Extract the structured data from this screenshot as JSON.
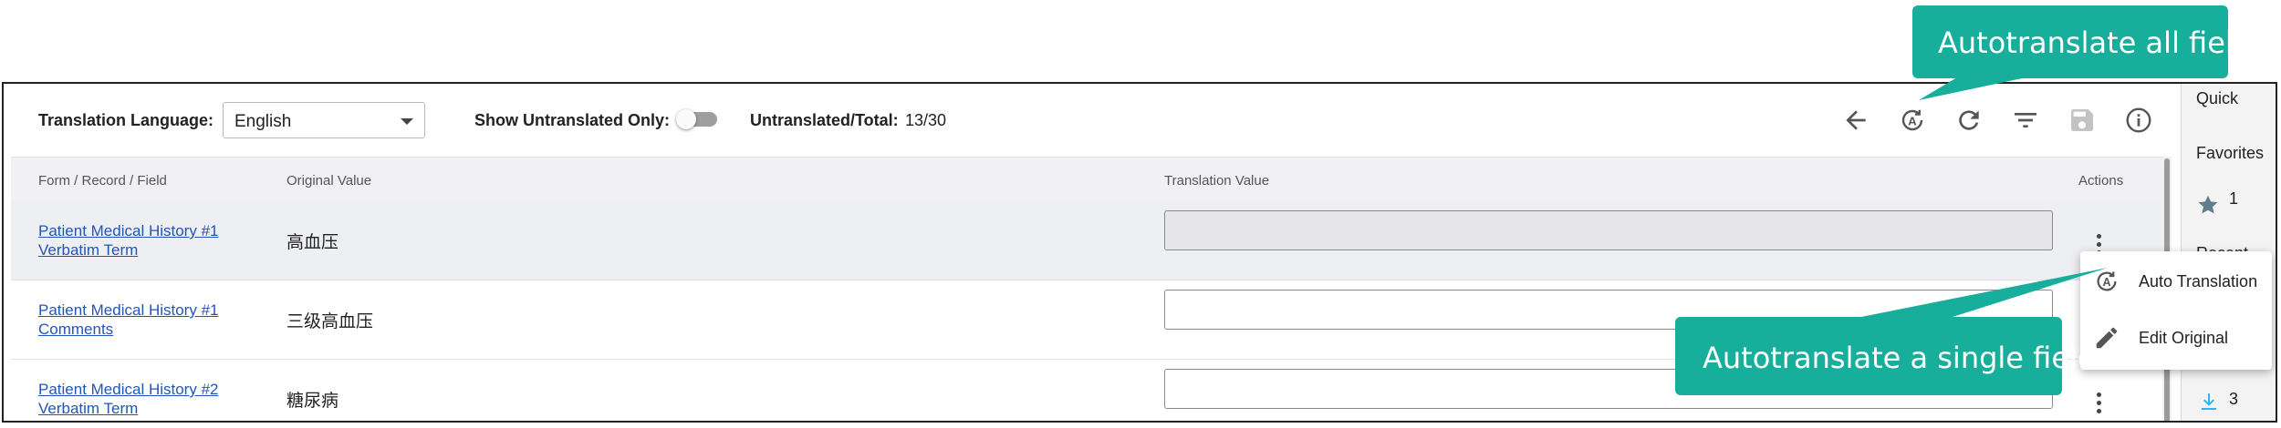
{
  "toolbar": {
    "language_label": "Translation Language:",
    "language_value": "English",
    "untranslated_only_label": "Show Untranslated Only:",
    "count_label": "Untranslated/Total:",
    "count_value": "13/30",
    "icons": [
      "back-arrow-icon",
      "auto-translate-icon",
      "refresh-icon",
      "filter-icon",
      "save-icon",
      "info-icon"
    ]
  },
  "table": {
    "columns": [
      "Form / Record / Field",
      "Original Value",
      "Translation Value",
      "Actions"
    ],
    "rows": [
      {
        "field_line1": "Patient Medical History #1",
        "field_line2": "Verbatim Term",
        "original": "高血压",
        "translation": ""
      },
      {
        "field_line1": "Patient Medical History #1",
        "field_line2": "Comments",
        "original": "三级高血压",
        "translation": ""
      },
      {
        "field_line1": "Patient Medical History #2",
        "field_line2": "Verbatim Term",
        "original": "糖尿病",
        "translation": ""
      }
    ]
  },
  "sidebar": {
    "quick": "Quick",
    "favorites": "Favorites",
    "favorites_count": "1",
    "recent": "Recent",
    "downloads_count": "3"
  },
  "menu": {
    "auto_translation": "Auto Translation",
    "edit_original": "Edit Original"
  },
  "callouts": {
    "all_fields": "Autotranslate all fields",
    "single_field": "Autotranslate a single field"
  },
  "colors": {
    "callout": "#17ae9b",
    "link": "#2255bb",
    "star": "#607d8b",
    "download": "#29b6f6"
  }
}
